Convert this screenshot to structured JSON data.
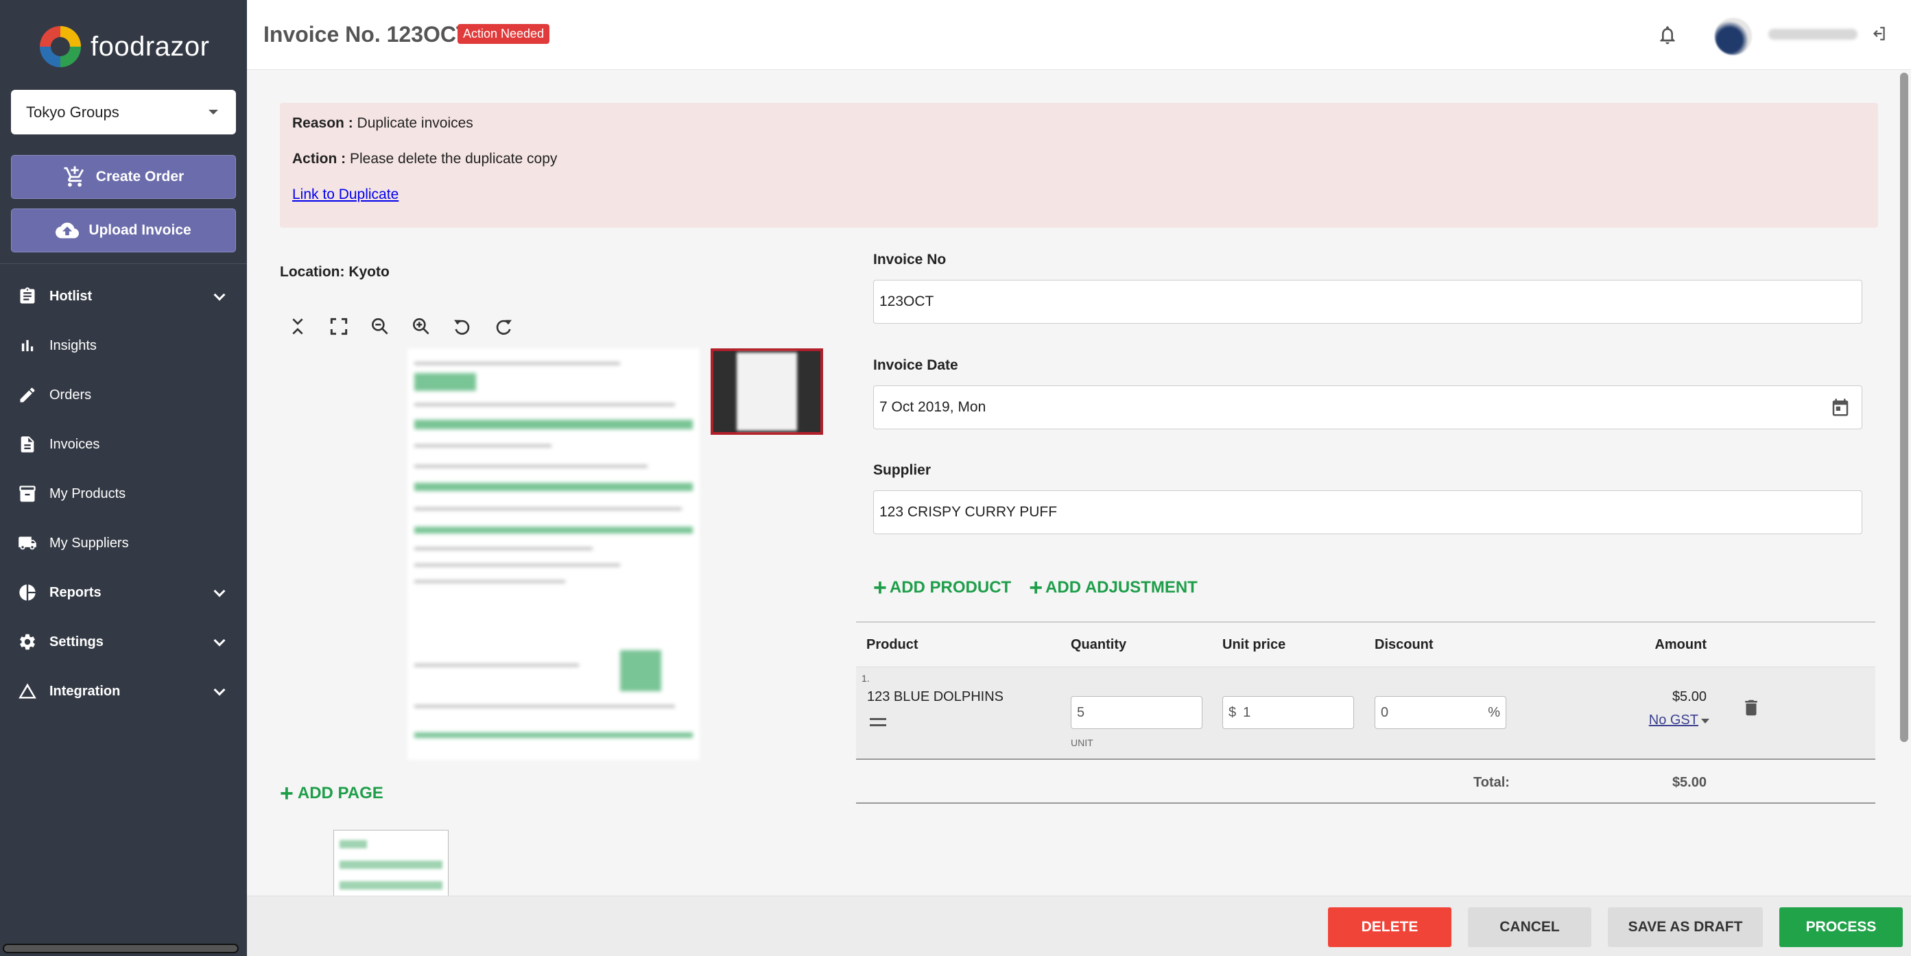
{
  "app": {
    "brand": "foodrazor"
  },
  "sidebar": {
    "org_select": "Tokyo Groups",
    "create_order": "Create Order",
    "upload_invoice": "Upload Invoice",
    "items": [
      {
        "label": "Hotlist",
        "icon": "clipboard-icon",
        "expandable": true
      },
      {
        "label": "Insights",
        "icon": "bar-chart-icon",
        "expandable": false
      },
      {
        "label": "Orders",
        "icon": "edit-icon",
        "expandable": false
      },
      {
        "label": "Invoices",
        "icon": "document-icon",
        "expandable": false
      },
      {
        "label": "My Products",
        "icon": "archive-icon",
        "expandable": false
      },
      {
        "label": "My Suppliers",
        "icon": "truck-icon",
        "expandable": false
      },
      {
        "label": "Reports",
        "icon": "pie-chart-icon",
        "expandable": true
      },
      {
        "label": "Settings",
        "icon": "gear-icon",
        "expandable": true
      },
      {
        "label": "Integration",
        "icon": "triangle-icon",
        "expandable": true
      }
    ]
  },
  "header": {
    "title": "Invoice No. 123OCT",
    "badge": "Action Needed"
  },
  "alert": {
    "reason_label": "Reason :",
    "reason_text": "Duplicate invoices",
    "action_label": "Action :",
    "action_text": "Please delete the duplicate copy",
    "link": "Link to Duplicate"
  },
  "viewer": {
    "location": "Location: Kyoto",
    "add_page": "ADD PAGE"
  },
  "form": {
    "invoice_no_label": "Invoice No",
    "invoice_no": "123OCT",
    "invoice_date_label": "Invoice Date",
    "invoice_date": "7 Oct 2019, Mon",
    "supplier_label": "Supplier",
    "supplier": "123 CRISPY CURRY PUFF",
    "add_product": "ADD PRODUCT",
    "add_adjustment": "ADD ADJUSTMENT"
  },
  "table": {
    "headers": {
      "product": "Product",
      "quantity": "Quantity",
      "unit_price": "Unit price",
      "discount": "Discount",
      "amount": "Amount"
    },
    "rows": [
      {
        "index": "1.",
        "product": "123 BLUE DOLPHINS",
        "quantity": "5",
        "unit": "UNIT",
        "currency": "$",
        "unit_price": "1",
        "discount": "0",
        "discount_unit": "%",
        "amount": "$5.00",
        "tax": "No GST"
      }
    ],
    "total_label": "Total:",
    "total_value": "$5.00"
  },
  "actions": {
    "delete": "DELETE",
    "cancel": "CANCEL",
    "save_draft": "SAVE AS DRAFT",
    "process": "PROCESS"
  },
  "colors": {
    "sidebar_bg": "#343a45",
    "accent_purple": "#6b6cab",
    "green": "#21a34a",
    "danger": "#f04438",
    "alert_bg": "#f5e4e4"
  }
}
